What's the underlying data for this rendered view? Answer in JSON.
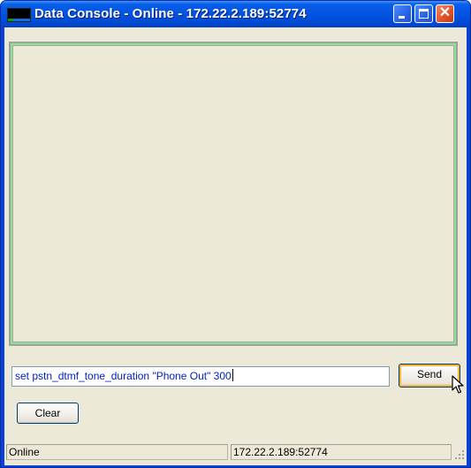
{
  "window": {
    "title": "Data Console - Online - 172.22.2.189:52774",
    "icon": "app-console-icon",
    "controls": [
      "minimize-icon",
      "maximize-icon",
      "close-icon"
    ]
  },
  "console": {
    "output_text": ""
  },
  "command": {
    "value": "set pstn_dtmf_tone_duration \"Phone Out\" 300"
  },
  "buttons": {
    "send_label": "Send",
    "clear_label": "Clear"
  },
  "status": {
    "state": "Online",
    "address": "172.22.2.189:52774"
  },
  "colors": {
    "titlebar": "#0053e1",
    "close_button": "#e4532a",
    "console_border": "#8ee38e",
    "input_text": "#0020c0",
    "client_background": "#ece9d8"
  }
}
